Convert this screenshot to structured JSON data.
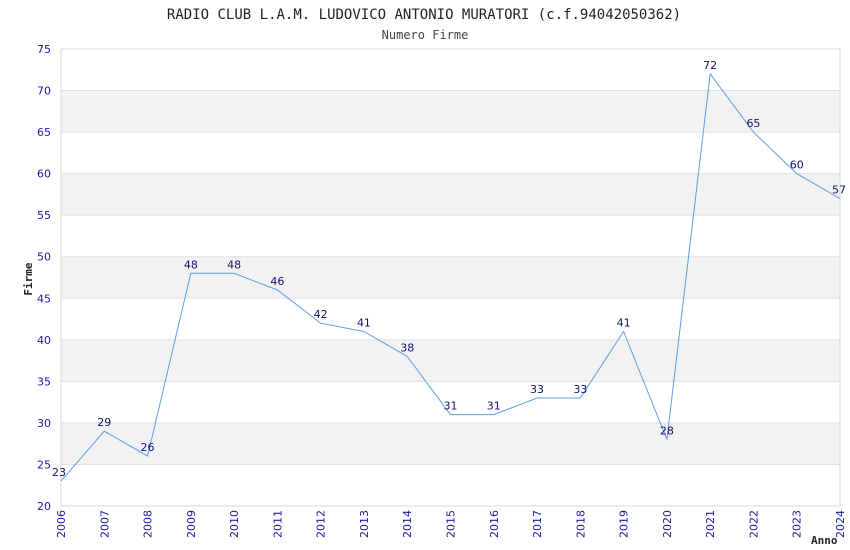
{
  "chart_data": {
    "type": "line",
    "title": "RADIO CLUB L.A.M. LUDOVICO ANTONIO MURATORI (c.f.94042050362)",
    "subtitle": "Numero Firme",
    "xlabel": "Anno",
    "ylabel": "Firme",
    "x": [
      "2006",
      "2007",
      "2008",
      "2009",
      "2010",
      "2011",
      "2012",
      "2013",
      "2014",
      "2015",
      "2016",
      "2017",
      "2018",
      "2019",
      "2020",
      "2021",
      "2022",
      "2023",
      "2024"
    ],
    "values": [
      23,
      29,
      26,
      48,
      48,
      46,
      42,
      41,
      38,
      31,
      31,
      33,
      33,
      41,
      28,
      72,
      65,
      60,
      57
    ],
    "ylim": [
      20,
      75
    ],
    "yticks": [
      20,
      25,
      30,
      35,
      40,
      45,
      50,
      55,
      60,
      65,
      70,
      75
    ],
    "grid": true,
    "colors": {
      "line": "#5aa0e6",
      "band": "#f2f2f2",
      "tick": "#1a1aa0"
    }
  }
}
